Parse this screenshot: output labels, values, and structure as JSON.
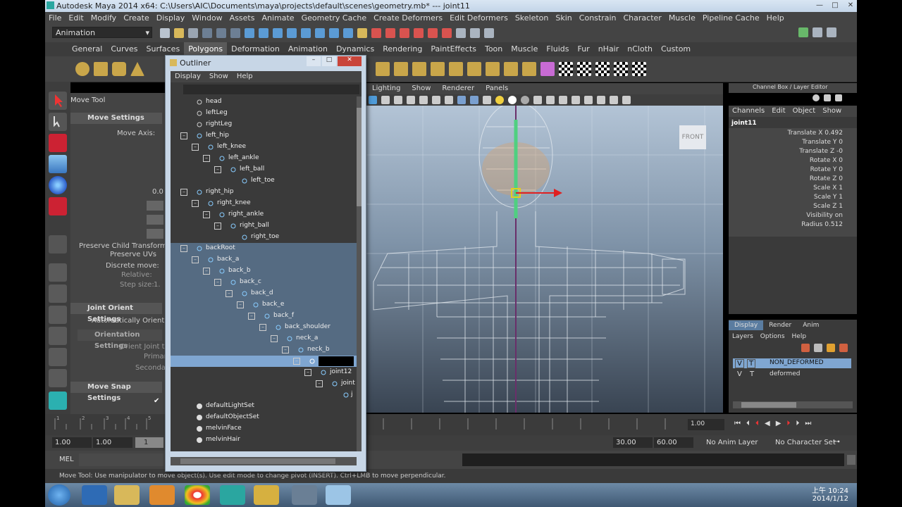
{
  "window": {
    "title": "Autodesk Maya 2014 x64: C:\\Users\\AIC\\Documents\\maya\\projects\\default\\scenes\\geometry.mb*  ---  joint11"
  },
  "menubar": [
    "File",
    "Edit",
    "Modify",
    "Create",
    "Display",
    "Window",
    "Assets",
    "Animate",
    "Geometry Cache",
    "Create Deformers",
    "Edit Deformers",
    "Skeleton",
    "Skin",
    "Constrain",
    "Character",
    "Muscle",
    "Pipeline Cache",
    "Help"
  ],
  "status": {
    "menuset": "Animation"
  },
  "shelf_tabs": [
    "General",
    "Curves",
    "Surfaces",
    "Polygons",
    "Deformation",
    "Animation",
    "Dynamics",
    "Rendering",
    "PaintEffects",
    "Toon",
    "Muscle",
    "Fluids",
    "Fur",
    "nHair",
    "nCloth",
    "Custom"
  ],
  "shelf_active": "Polygons",
  "tool_settings": {
    "title": "Move Tool",
    "move_settings": "Move Settings",
    "move_axis": "Move Axis:",
    "value_a": "0.0",
    "preserve_child": "Preserve Child Transform",
    "preserve_uvs": "Preserve UVs",
    "discrete_move": "Discrete move:",
    "relative": "Relative:",
    "step_size": "Step size:",
    "step_value": "1.",
    "joint_orient": "Joint Orient Settings",
    "auto_orient": "Automatically Orient Joints",
    "orientation": "Orientation Settings",
    "orient_joint": "Orient Joint to",
    "primary": "Primar",
    "secondary": "Secondar",
    "snap": "Move Snap Settings"
  },
  "viewport": {
    "menu": [
      "Lighting",
      "Show",
      "Renderer",
      "Panels"
    ],
    "cube_label": "FRONT"
  },
  "channel_box": {
    "header": "Channel Box / Layer Editor",
    "tabs": [
      "Channels",
      "Edit",
      "Object",
      "Show"
    ],
    "object": "joint11",
    "attrs": [
      "Translate X 0.492",
      "Translate Y 0",
      "Translate Z -0",
      "Rotate X 0",
      "Rotate Y 0",
      "Rotate Z 0",
      "Scale X 1",
      "Scale Y 1",
      "Scale Z 1",
      "Visibility on",
      "Radius 0.512"
    ]
  },
  "layers": {
    "tabs": [
      "Display",
      "Render",
      "Anim"
    ],
    "menu": [
      "Layers",
      "Options",
      "Help"
    ],
    "items": [
      {
        "v": "V",
        "t": "T",
        "name": "NON_DEFORMED"
      },
      {
        "v": "V",
        "t": "T",
        "name": "deformed"
      }
    ]
  },
  "outliner": {
    "title": "Outliner",
    "menu": [
      "Display",
      "Show",
      "Help"
    ],
    "rows": [
      {
        "name": "head"
      },
      {
        "name": "leftLeg"
      },
      {
        "name": "rightLeg"
      },
      {
        "name": "left_hip"
      },
      {
        "name": "left_knee"
      },
      {
        "name": "left_ankle"
      },
      {
        "name": "left_ball"
      },
      {
        "name": "left_toe"
      },
      {
        "name": "right_hip"
      },
      {
        "name": "right_knee"
      },
      {
        "name": "right_ankle"
      },
      {
        "name": "right_ball"
      },
      {
        "name": "right_toe"
      },
      {
        "name": "backRoot"
      },
      {
        "name": "back_a"
      },
      {
        "name": "back_b"
      },
      {
        "name": "back_c"
      },
      {
        "name": "back_d"
      },
      {
        "name": "back_e"
      },
      {
        "name": "back_f"
      },
      {
        "name": "back_shoulder"
      },
      {
        "name": "neck_a"
      },
      {
        "name": "neck_b"
      },
      {
        "name": ""
      },
      {
        "name": "joint12"
      },
      {
        "name": "joint"
      },
      {
        "name": "j"
      },
      {
        "name": ""
      },
      {
        "name": "defaultLightSet"
      },
      {
        "name": "defaultObjectSet"
      },
      {
        "name": "melvinFace"
      },
      {
        "name": "melvinHair"
      }
    ]
  },
  "timeline": {
    "ticks": [
      "1",
      "2",
      "3",
      "4",
      "5"
    ],
    "current": "1.00"
  },
  "range": {
    "start": "1.00",
    "start2": "1.00",
    "cur": "1",
    "end1": "30.00",
    "end2": "60.00",
    "anim_layer": "No Anim Layer",
    "char_set": "No Character Set"
  },
  "mel": {
    "label": "MEL"
  },
  "help": {
    "text": "Move Tool: Use manipulator to move object(s). Use edit mode to change pivot (INSERT). Ctrl+LMB to move perpendicular."
  },
  "clock": {
    "time": "上午 10:24",
    "date": "2014/1/12"
  }
}
